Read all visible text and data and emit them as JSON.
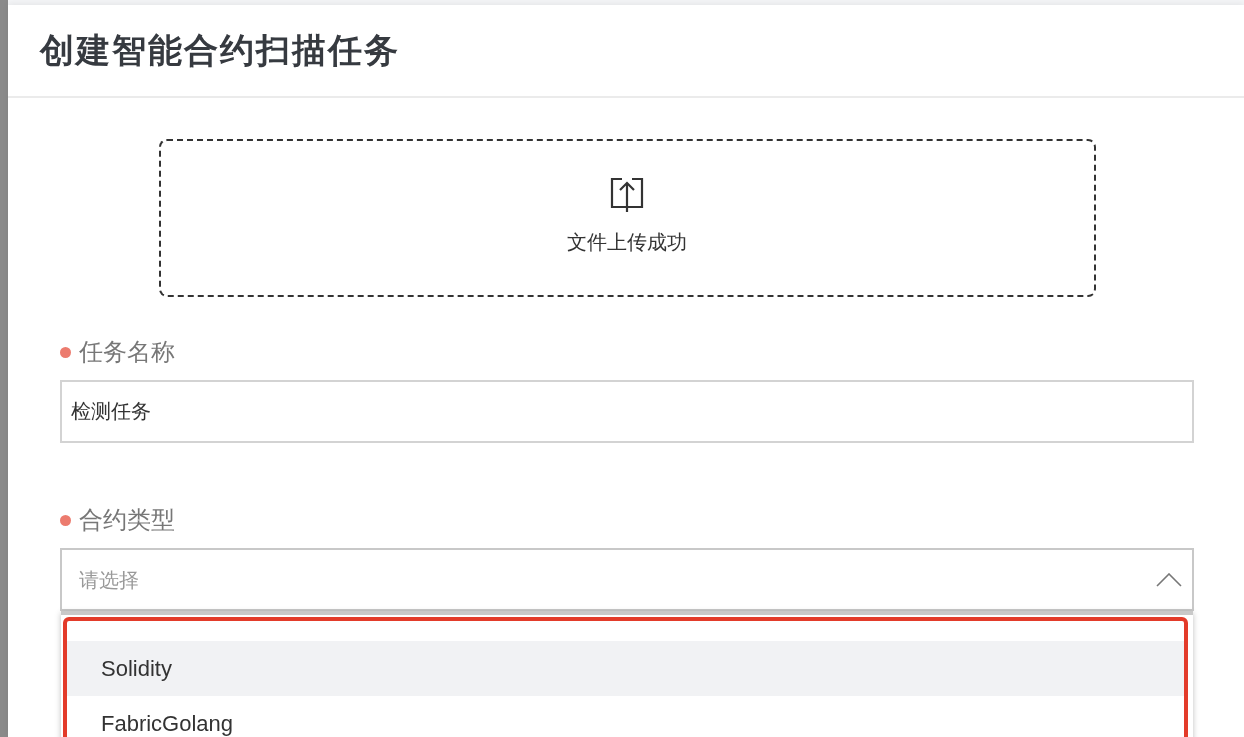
{
  "dialog": {
    "title": "创建智能合约扫描任务"
  },
  "upload": {
    "status": "文件上传成功"
  },
  "fields": [
    {
      "kind": "text",
      "label": "任务名称",
      "required": true,
      "value": "检测任务"
    },
    {
      "kind": "select",
      "label": "合约类型",
      "required": true,
      "placeholder": "请选择",
      "expanded": true,
      "options": [
        {
          "label": "Solidity",
          "selected": true
        },
        {
          "label": "FabricGolang",
          "selected": false
        }
      ]
    }
  ]
}
